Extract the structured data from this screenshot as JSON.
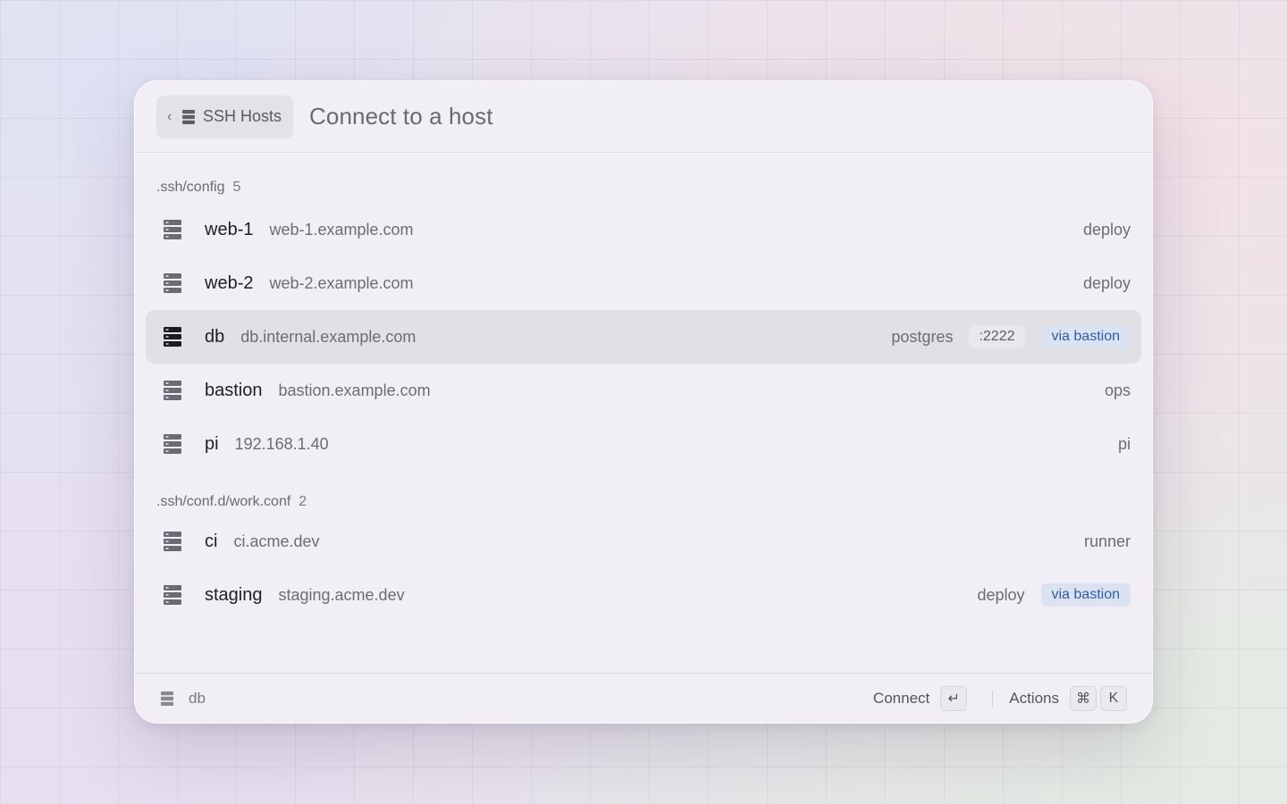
{
  "header": {
    "back_label": "SSH Hosts",
    "title": "Connect to a host",
    "back_icon": "chevron-left-icon",
    "section_icon": "server-icon"
  },
  "sections": [
    {
      "title": ".ssh/config",
      "count": "5",
      "hosts": [
        {
          "name": "web-1",
          "host": "web-1.example.com",
          "user": "deploy"
        },
        {
          "name": "web-2",
          "host": "web-2.example.com",
          "user": "deploy"
        },
        {
          "name": "db",
          "host": "db.internal.example.com",
          "user": "postgres",
          "port": ":2222",
          "via": "via bastion",
          "selected": true
        },
        {
          "name": "bastion",
          "host": "bastion.example.com",
          "user": "ops"
        },
        {
          "name": "pi",
          "host": "192.168.1.40",
          "user": "pi"
        }
      ]
    },
    {
      "title": ".ssh/conf.d/work.conf",
      "count": "2",
      "hosts": [
        {
          "name": "ci",
          "host": "ci.acme.dev",
          "user": "runner"
        },
        {
          "name": "staging",
          "host": "staging.acme.dev",
          "user": "deploy",
          "via": "via bastion"
        }
      ]
    }
  ],
  "footer": {
    "selected_host": "db",
    "primary_action": "Connect",
    "primary_key": "↵",
    "secondary_action": "Actions",
    "secondary_keys": [
      "⌘",
      "K"
    ]
  },
  "colors": {
    "accent_badge_bg": "#dbe3f3",
    "accent_badge_text": "#2f5ca8",
    "selected_row_bg": "#e2e0e5"
  }
}
